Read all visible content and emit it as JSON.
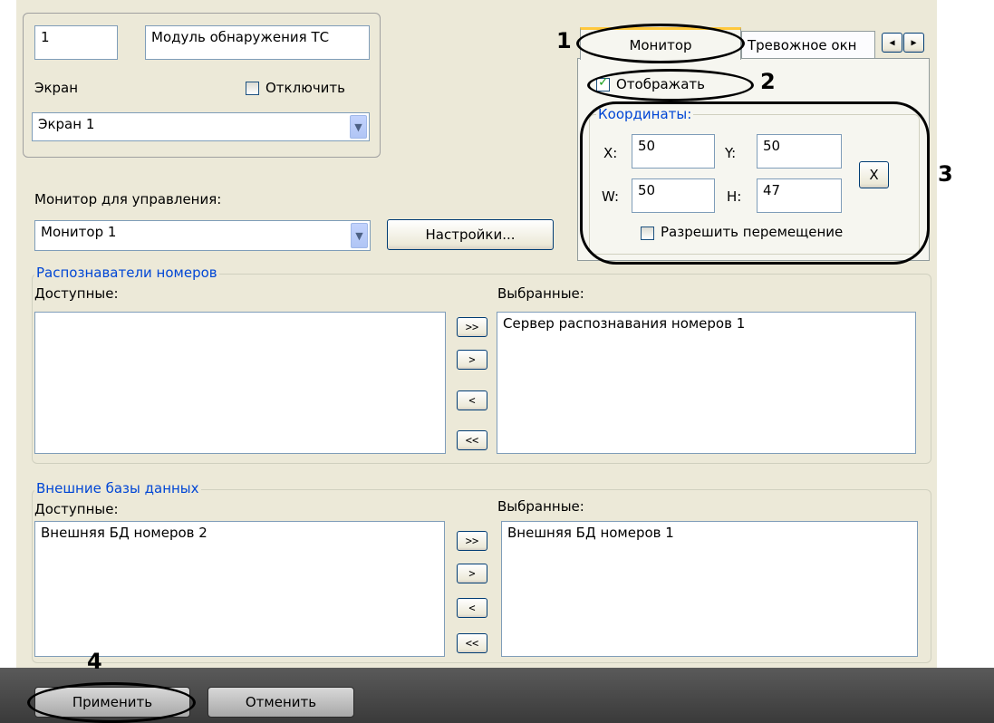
{
  "top": {
    "id_value": "1",
    "name_value": "Модуль обнаружения ТС",
    "screen_label": "Экран",
    "disable_label": "Отключить",
    "screen_value": "Экран 1"
  },
  "monitor": {
    "label": "Монитор для управления:",
    "value": "Монитор 1",
    "settings_button": "Настройки..."
  },
  "tabs": {
    "monitor": "Монитор",
    "alarm": "Тревожное окн",
    "show_label": "Отображать",
    "coords_legend": "Координаты:",
    "x_label": "X:",
    "x_value": "50",
    "y_label": "Y:",
    "y_value": "50",
    "w_label": "W:",
    "w_value": "50",
    "h_label": "H:",
    "h_value": "47",
    "clear_button": "X",
    "allow_move_label": "Разрешить перемещение"
  },
  "recognizers": {
    "legend": "Распознаватели номеров",
    "available_label": "Доступные:",
    "selected_label": "Выбранные:",
    "available_items": [],
    "selected_items": [
      "Сервер распознавания номеров 1"
    ]
  },
  "external_db": {
    "legend": "Внешние базы данных",
    "available_label": "Доступные:",
    "selected_label": "Выбранные:",
    "available_items": [
      "Внешняя БД номеров 2"
    ],
    "selected_items": [
      "Внешняя БД номеров 1"
    ]
  },
  "transfer_buttons": {
    "add_all": ">>",
    "add": ">",
    "remove": "<",
    "remove_all": "<<"
  },
  "footer": {
    "apply": "Применить",
    "cancel": "Отменить"
  },
  "annotations": {
    "n1": "1",
    "n2": "2",
    "n3": "3",
    "n4": "4"
  },
  "colors": {
    "panel": "#ece9d8",
    "legend_blue": "#0046d5",
    "footer_bar": "#4a4a4a"
  }
}
